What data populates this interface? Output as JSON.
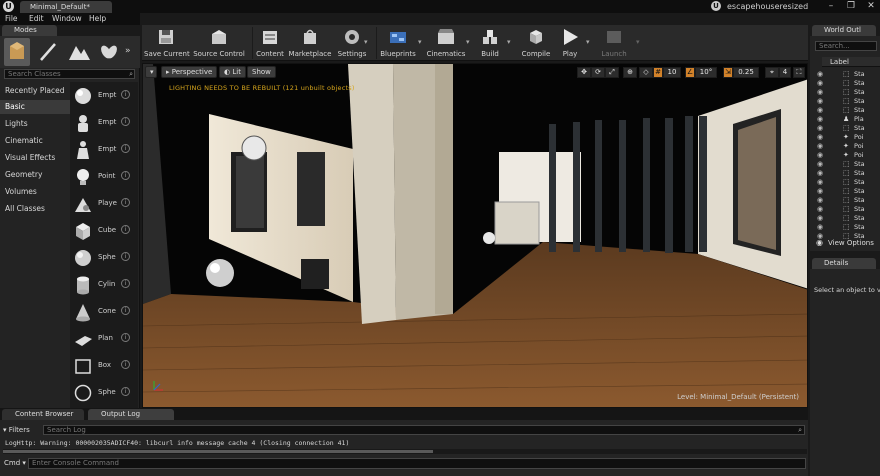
{
  "titlebar": {
    "app_logo": "U",
    "tab_label": "Minimal_Default*",
    "project_logo": "U",
    "project_name": "escapehouseresized",
    "minimize": "–",
    "restore": "❐",
    "close": "✕"
  },
  "menu": [
    "File",
    "Edit",
    "Window",
    "Help"
  ],
  "modes": {
    "tab_label": "Modes",
    "search_placeholder": "Search Classes",
    "categories": [
      "Recently Placed",
      "Basic",
      "Lights",
      "Cinematic",
      "Visual Effects",
      "Geometry",
      "Volumes",
      "All Classes"
    ],
    "active_category": "Basic",
    "placeables": [
      {
        "label": "Empt",
        "icon": "sphere-icon"
      },
      {
        "label": "Empt",
        "icon": "pawn-icon"
      },
      {
        "label": "Empt",
        "icon": "character-icon"
      },
      {
        "label": "Point",
        "icon": "point-light-icon"
      },
      {
        "label": "Playe",
        "icon": "player-start-icon"
      },
      {
        "label": "Cube",
        "icon": "cube-icon"
      },
      {
        "label": "Sphe",
        "icon": "sphere-icon"
      },
      {
        "label": "Cylin",
        "icon": "cylinder-icon"
      },
      {
        "label": "Cone",
        "icon": "cone-icon"
      },
      {
        "label": "Plan",
        "icon": "plane-icon"
      },
      {
        "label": "Box",
        "icon": "box-trigger-icon"
      },
      {
        "label": "Sphe",
        "icon": "sphere-trigger-icon"
      }
    ],
    "info_glyph": "i"
  },
  "toolbar": {
    "buttons": [
      {
        "label": "Save Current",
        "icon": "save-icon"
      },
      {
        "label": "Source Control",
        "icon": "source-control-icon"
      },
      {
        "label": "Content",
        "icon": "content-icon"
      },
      {
        "label": "Marketplace",
        "icon": "marketplace-icon"
      },
      {
        "label": "Settings",
        "icon": "settings-icon"
      },
      {
        "label": "Blueprints",
        "icon": "blueprints-icon"
      },
      {
        "label": "Cinematics",
        "icon": "cinematics-icon"
      },
      {
        "label": "Build",
        "icon": "build-icon"
      },
      {
        "label": "Compile",
        "icon": "compile-icon"
      },
      {
        "label": "Play",
        "icon": "play-icon"
      },
      {
        "label": "Launch",
        "icon": "launch-icon"
      }
    ]
  },
  "viewport": {
    "perspective_label": "Perspective",
    "lit_label": "Lit",
    "show_label": "Show",
    "grid_snap": "10",
    "rotation_snap": "10°",
    "scale_snap": "0.25",
    "camera_speed": "4",
    "lighting_warning": "LIGHTING NEEDS TO BE REBUILT (121 unbuilt objects)",
    "level_label": "Level: Minimal_Default (Persistent)"
  },
  "bottom": {
    "tabs": [
      "Content Browser",
      "Output Log"
    ],
    "active_tab": "Output Log",
    "filters_label": "Filters",
    "search_placeholder": "Search Log",
    "log_line": "LogHttp: Warning: 000002035ADICF40: libcurl info message cache 4 (Closing connection 41)",
    "cmd_label": "Cmd",
    "cmd_placeholder": "Enter Console Command"
  },
  "outliner": {
    "tab_label": "World Outl",
    "search_placeholder": "Search...",
    "header_label": "Label",
    "rows": [
      {
        "label": "Sta",
        "icon": "static-mesh-icon"
      },
      {
        "label": "Sta",
        "icon": "static-mesh-icon"
      },
      {
        "label": "Sta",
        "icon": "static-mesh-icon"
      },
      {
        "label": "Sta",
        "icon": "static-mesh-icon"
      },
      {
        "label": "Sta",
        "icon": "static-mesh-icon"
      },
      {
        "label": "Pla",
        "icon": "player-start-icon"
      },
      {
        "label": "Sta",
        "icon": "static-mesh-icon"
      },
      {
        "label": "Poi",
        "icon": "point-light-icon"
      },
      {
        "label": "Poi",
        "icon": "point-light-icon"
      },
      {
        "label": "Poi",
        "icon": "point-light-icon"
      },
      {
        "label": "Sta",
        "icon": "static-mesh-icon"
      },
      {
        "label": "Sta",
        "icon": "static-mesh-icon"
      },
      {
        "label": "Sta",
        "icon": "static-mesh-icon"
      },
      {
        "label": "Sta",
        "icon": "static-mesh-icon"
      },
      {
        "label": "Sta",
        "icon": "static-mesh-icon"
      },
      {
        "label": "Sta",
        "icon": "static-mesh-icon"
      },
      {
        "label": "Sta",
        "icon": "static-mesh-icon"
      },
      {
        "label": "Sta",
        "icon": "static-mesh-icon"
      },
      {
        "label": "Sta",
        "icon": "static-mesh-icon"
      }
    ],
    "view_options_label": "View Options"
  },
  "details": {
    "tab_label": "Details",
    "hint": "Select an object to vi"
  },
  "colors": {
    "accent_orange": "#d2822a",
    "warning_yellow": "#d6a51c",
    "panel_bg": "#232323",
    "toolbar_bg": "#2a2a2a"
  }
}
